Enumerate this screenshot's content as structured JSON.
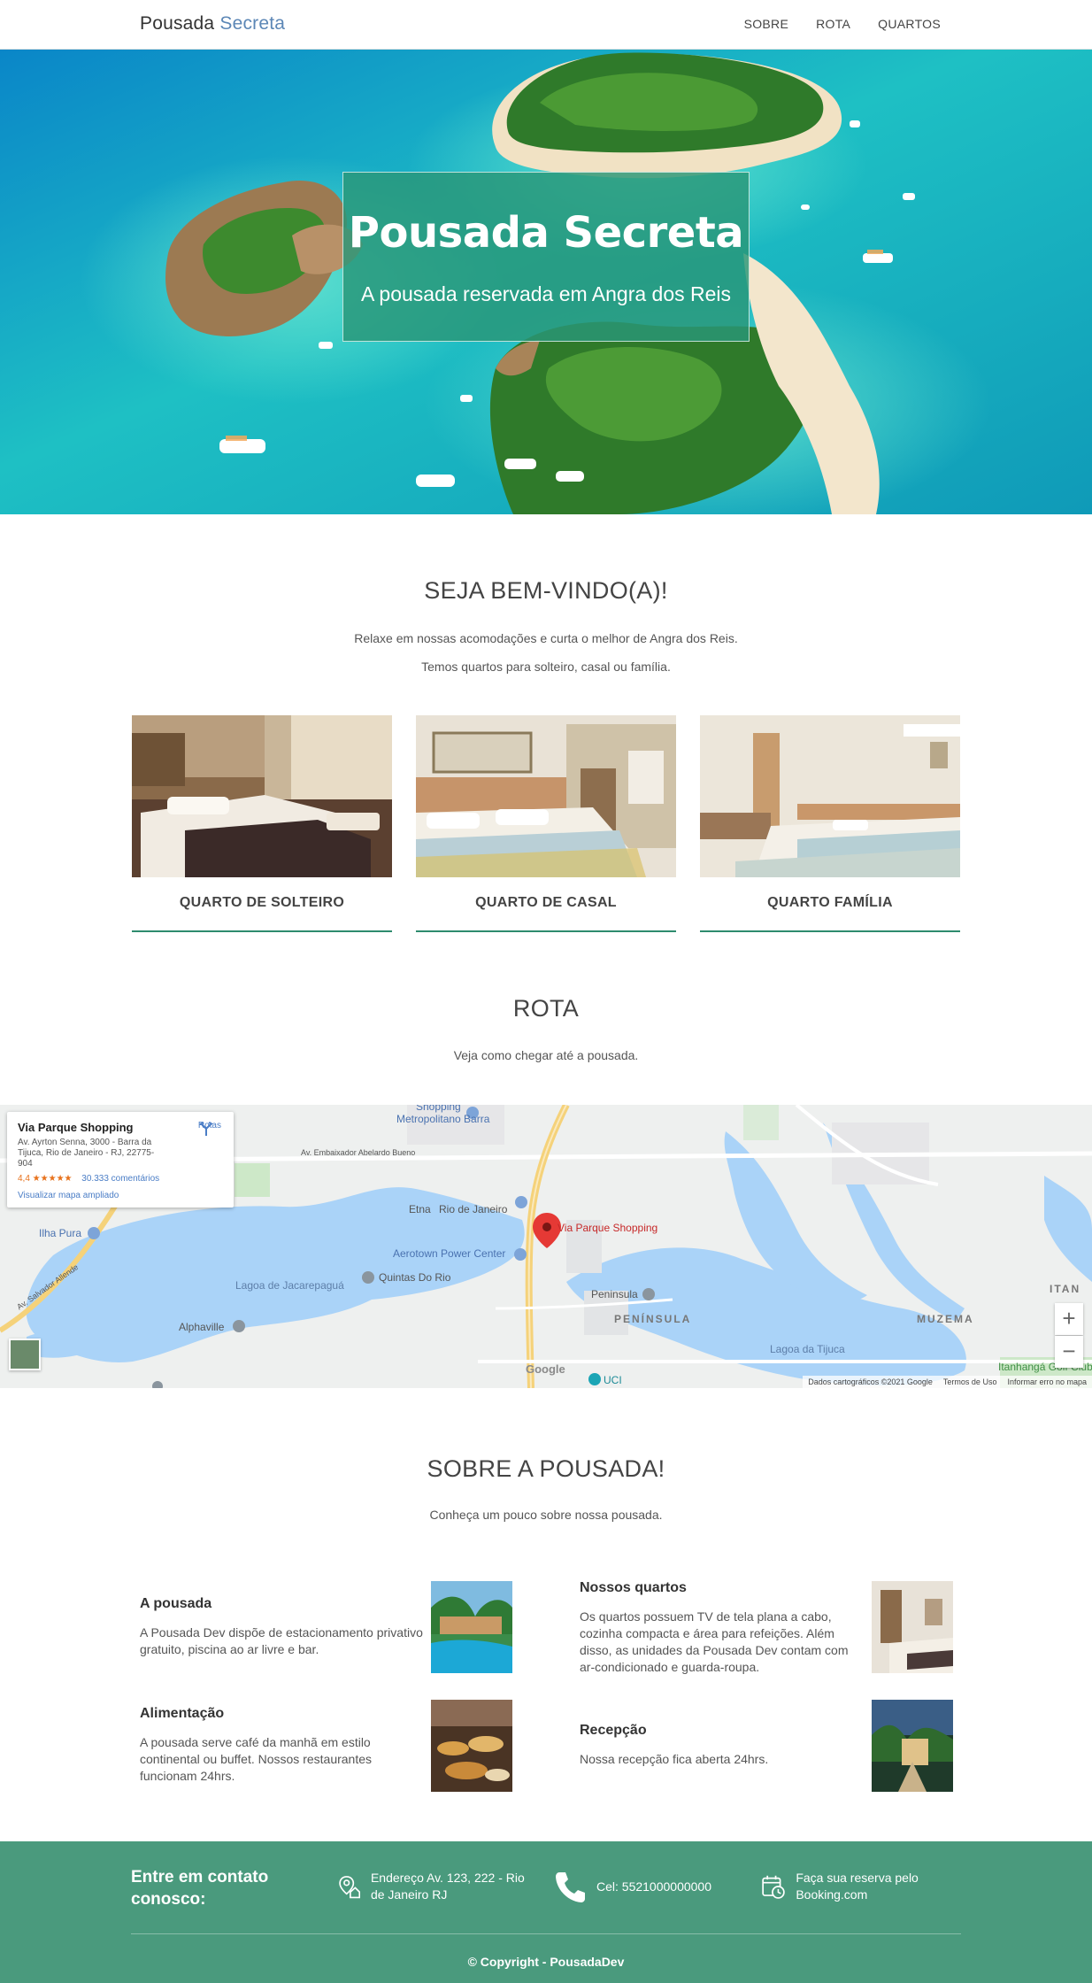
{
  "navbar": {
    "brand_first": "Pousada",
    "brand_second": "Secreta",
    "links": [
      "SOBRE",
      "ROTA",
      "QUARTOS"
    ]
  },
  "hero": {
    "title": "Pousada Secreta",
    "subtitle": "A pousada reservada em Angra dos Reis"
  },
  "welcome": {
    "title": "SEJA BEM-VINDO(A)!",
    "line1": "Relaxe em nossas acomodações e curta o melhor de Angra dos Reis.",
    "line2": "Temos quartos para solteiro, casal ou família."
  },
  "rooms": [
    {
      "label": "QUARTO DE SOLTEIRO"
    },
    {
      "label": "QUARTO DE CASAL"
    },
    {
      "label": "QUARTO FAMÍLIA"
    }
  ],
  "route": {
    "title": "ROTA",
    "text": "Veja como chegar até a pousada."
  },
  "map": {
    "place_name": "Via Parque Shopping",
    "address": "Av. Ayrton Senna, 3000 - Barra da Tijuca, Rio de Janeiro - RJ, 22775-904",
    "rating": "4,4 ★★★★★",
    "reviews": "30.333 comentários",
    "view_larger": "Visualizar mapa ampliado",
    "directions": "Rotas",
    "marker_label": "Via Parque Shopping",
    "labels": {
      "shopping": "Shopping",
      "metropolitano": "Metropolitano Barra",
      "embaixador": "Av. Embaixador Abelardo Bueno",
      "etna": "Etna",
      "rio": "Rio de Janeiro",
      "aerotown": "Aerotown Power Center",
      "ilha_pura": "Ilha Pura",
      "salvador": "Av. Salvador Allende",
      "lagoa_jac": "Lagoa de Jacarepaguá",
      "quintas": "Quintas Do Rio",
      "alphaville": "Alphaville",
      "peninsula": "Peninsula",
      "peninsula_upper": "PENÍNSULA",
      "lagoa_tijuca": "Lagoa da Tijuca",
      "muzema": "MUZEMA",
      "itan": "ITAN",
      "itanhanga": "Itanhangá Golf Club",
      "uci": "UCI",
      "google": "Google"
    },
    "zoom_in": "+",
    "zoom_out": "−",
    "attribution": [
      "Dados cartográficos ©2021 Google",
      "Termos de Uso",
      "Informar erro no mapa"
    ]
  },
  "about": {
    "title": "SOBRE A POUSADA!",
    "text": "Conheça um pouco sobre nossa pousada.",
    "items": [
      {
        "title": "A pousada",
        "text": "A Pousada Dev dispõe de estacionamento privativo gratuito, piscina ao ar livre e bar."
      },
      {
        "title": "Nossos quartos",
        "text": "Os quartos possuem TV de tela plana a cabo, cozinha compacta e área para refeições. Além disso, as unidades da Pousada Dev contam com ar-condicionado e guarda-roupa."
      },
      {
        "title": "Alimentação",
        "text": "A pousada serve café da manhã em estilo continental ou buffet. Nossos restaurantes funcionam 24hrs."
      },
      {
        "title": "Recepção",
        "text": "Nossa recepção fica aberta 24hrs."
      }
    ]
  },
  "footer": {
    "title": "Entre em contato conosco:",
    "address": "Endereço Av. 123, 222 - Rio de Janeiro RJ",
    "phone": "Cel: 5521000000000",
    "booking": "Faça sua reserva pelo Booking.com",
    "copyright": "© Copyright - PousadaDev"
  },
  "colors": {
    "accent": "#4a9a7d",
    "brand_blue": "#5c87b6",
    "link_blue": "#4a7dc6"
  }
}
